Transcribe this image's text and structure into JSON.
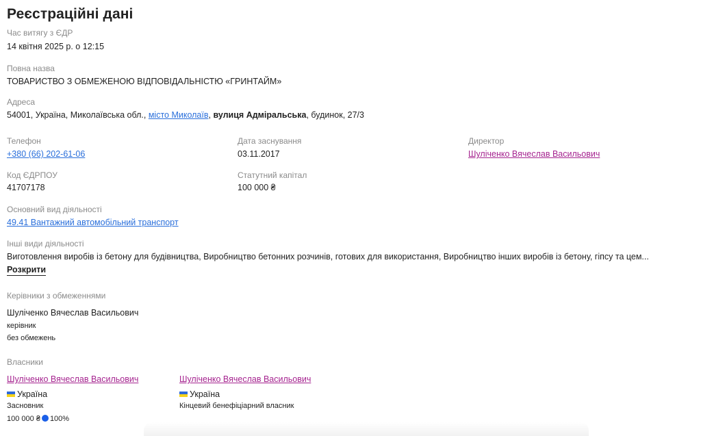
{
  "title": "Реєстраційні дані",
  "extract_time": {
    "label": "Час витягу з ЄДР",
    "value": "14 квітня 2025 р. о 12:15"
  },
  "full_name": {
    "label": "Повна назва",
    "value": "ТОВАРИСТВО З ОБМЕЖЕНОЮ ВІДПОВІДАЛЬНІСТЮ «ГРИНТАЙМ»"
  },
  "address": {
    "label": "Адреса",
    "prefix": "54001, Україна, Миколаївська обл., ",
    "city_link": "місто Миколаїв",
    "sep": ", ",
    "street": "вулиця Адміральська",
    "suffix": ", будинок, 27/3"
  },
  "phone": {
    "label": "Телефон",
    "value": "+380 (66) 202-61-06"
  },
  "founded": {
    "label": "Дата заснування",
    "value": "03.11.2017"
  },
  "director": {
    "label": "Директор",
    "value": "Шуліченко Вячеслав Васильович"
  },
  "edrpou": {
    "label": "Код ЄДРПОУ",
    "value": "41707178"
  },
  "capital": {
    "label": "Статутний капітал",
    "value": "100 000 ₴"
  },
  "main_activity": {
    "label": "Основний вид діяльності",
    "value": "49.41 Вантажний автомобільний транспорт"
  },
  "other_activities": {
    "label": "Інші види діяльності",
    "value": "Виготовлення виробів із бетону для будівництва, Виробництво бетонних розчинів, готових для використання, Виробництво інших виробів із бетону, гіпсу та цем...",
    "expand": "Розкрити"
  },
  "restricted": {
    "label": "Керівники з обмеженнями",
    "name": "Шуліченко Вячеслав Васильович",
    "role": "керівник",
    "status": "без обмежень"
  },
  "owners": {
    "label": "Власники",
    "items": [
      {
        "name": "Шуліченко Вячеслав Васильович",
        "country": "Україна",
        "role": "Засновник",
        "amount": "100 000 ₴",
        "share": "100%"
      },
      {
        "name": "Шуліченко Вячеслав Васильович",
        "country": "Україна",
        "role": "Кінцевий бенефіціарний власник"
      }
    ]
  },
  "colors": {
    "link": "#2a6fdb",
    "person_link": "#a5238f",
    "share_dot": "#1a5fe8"
  }
}
